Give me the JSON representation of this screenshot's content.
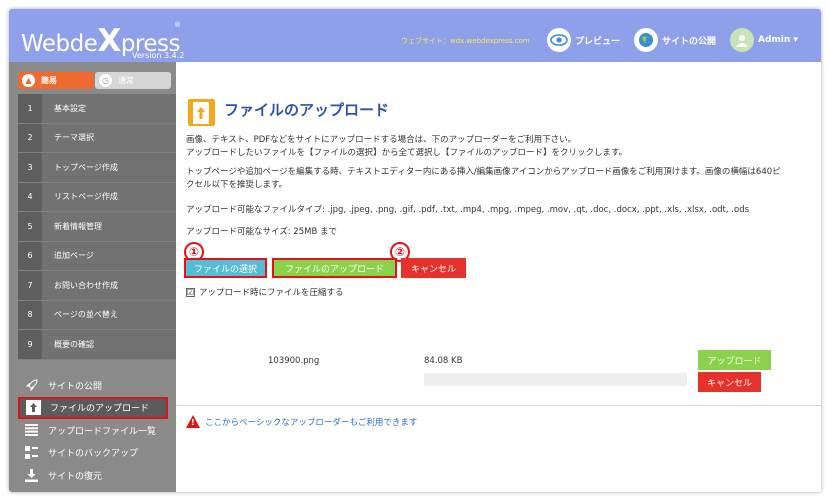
{
  "header": {
    "logo_a": "Webde",
    "logo_b": "X",
    "logo_c": "press",
    "reg_mark": "®",
    "version": "Version 3.4.2",
    "site_url": "ウェブサイト：wdx.webdexpress.com",
    "preview_label": "プレビュー",
    "publish_label": "サイトの公開",
    "admin_label": "Admin ▾"
  },
  "sidebar": {
    "mode_easy": "簡易",
    "mode_normal": "通常",
    "steps": [
      {
        "num": "1",
        "label": "基本設定"
      },
      {
        "num": "2",
        "label": "テーマ選択"
      },
      {
        "num": "3",
        "label": "トップページ作成"
      },
      {
        "num": "4",
        "label": "リストページ作成"
      },
      {
        "num": "5",
        "label": "新着情報管理"
      },
      {
        "num": "6",
        "label": "追加ページ"
      },
      {
        "num": "7",
        "label": "お問い合わせ作成"
      },
      {
        "num": "8",
        "label": "ページの並べ替え"
      },
      {
        "num": "9",
        "label": "概要の確認"
      }
    ],
    "links": [
      {
        "label": "サイトの公開",
        "icon": "rocket-icon"
      },
      {
        "label": "ファイルのアップロード",
        "icon": "upload-icon"
      },
      {
        "label": "アップロードファイル一覧",
        "icon": "list-icon"
      },
      {
        "label": "サイトのバックアップ",
        "icon": "backup-icon"
      },
      {
        "label": "サイトの復元",
        "icon": "download-icon"
      }
    ]
  },
  "main": {
    "title": "ファイルのアップロード",
    "intro_1": "画像、テキスト、PDFなどをサイトにアップロードする場合は、下のアップローダーをご利用下さい。",
    "intro_2": "アップロードしたいファイルを【ファイルの選択】から全て選択し【ファイルのアップロード】をクリックします。",
    "note_1": "トップページや追加ページを編集する時、テキストエディター内にある挿入/編集画像アイコンからアップロード画像をご利用頂けます。画像の横幅は640ピ",
    "note_2": "クセル以下を推奨します。",
    "types": "アップロード可能なファイルタイプ: .jpg, .jpeg, .png, .gif, .pdf, .txt, .mp4, .mpg, .mpeg, .mov, .qt, .doc, .docx, .ppt, .xls, .xlsx, .odt, .ods",
    "max_size": "アップロード可能なサイズ: 25MB まで",
    "select_button": "ファイルの選択",
    "upload_button": "ファイルのアップロード",
    "cancel_button": "キャンセル",
    "marker_1": "①",
    "marker_2": "②",
    "compress_label": "アップロード時にファイルを圧縮する",
    "compress_checked": "☑",
    "queue": {
      "file_name": "103900.png",
      "file_size": "84.08 KB",
      "progress": 0,
      "upload_label": "アップロード",
      "cancel_label": "キャンセル"
    },
    "basic_uploader_link": "ここからベーシックなアップローダーもご利用できます",
    "warn_glyph": "!"
  },
  "colors": {
    "header_bg": "#8fa0ea",
    "accent_blue": "#2b53a6",
    "green": "#8ad24c",
    "cyan": "#56bcd3",
    "red": "#e7322c",
    "highlight": "#e0131a",
    "orange": "#ef6a2e"
  }
}
